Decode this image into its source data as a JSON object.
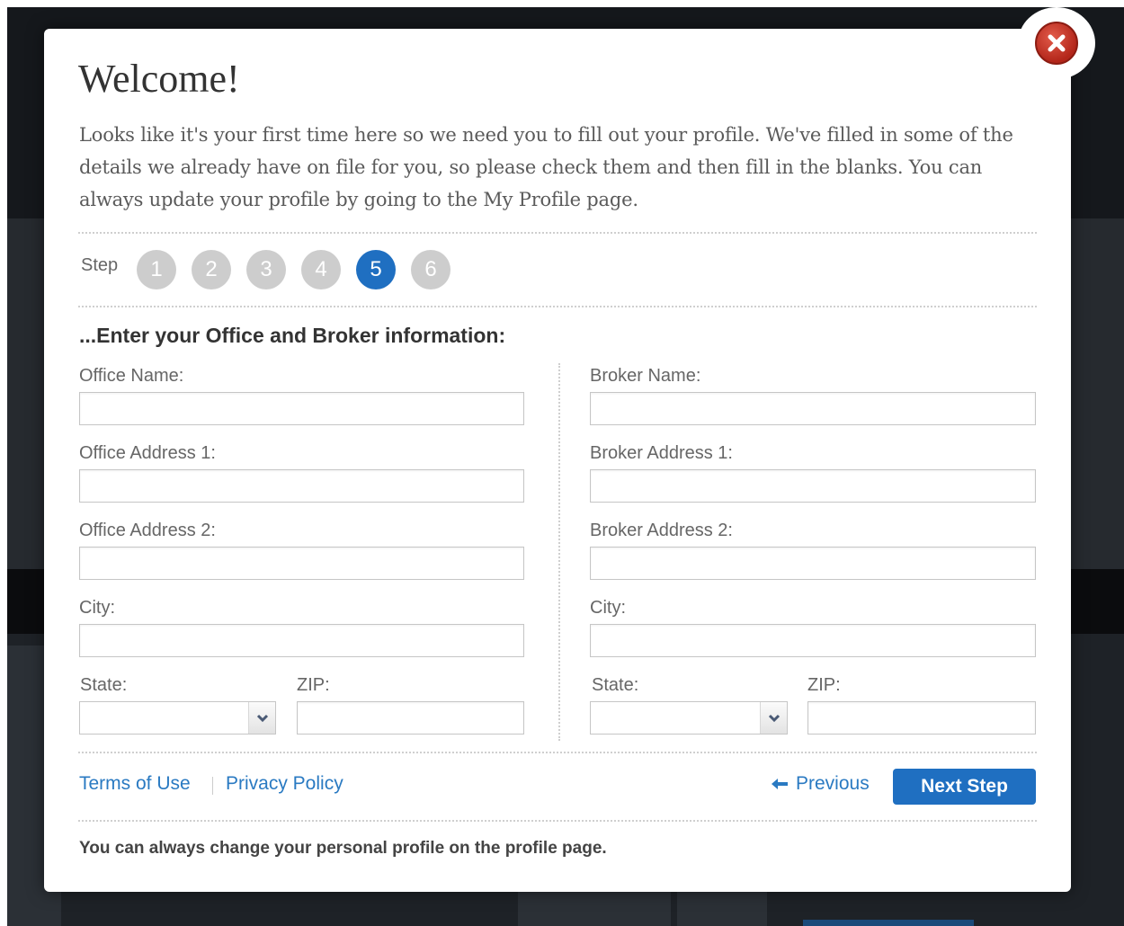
{
  "modal": {
    "title": "Welcome!",
    "intro": "Looks like it's your first time here so we need you to fill out your profile. We've filled in some of the details we already have on file for you, so please check them and then fill in the blanks. You can always update your profile by going to the My Profile page.",
    "close_icon": "close-icon"
  },
  "steps": {
    "label": "Step",
    "items": [
      "1",
      "2",
      "3",
      "4",
      "5",
      "6"
    ],
    "current": 5
  },
  "form": {
    "heading": "...Enter your Office and Broker information:",
    "office": {
      "name_label": "Office Name:",
      "name_value": "",
      "address1_label": "Office Address 1:",
      "address1_value": "",
      "address2_label": "Office Address 2:",
      "address2_value": "",
      "city_label": "City:",
      "city_value": "",
      "state_label": "State:",
      "state_value": "",
      "zip_label": "ZIP:",
      "zip_value": ""
    },
    "broker": {
      "name_label": "Broker Name:",
      "name_value": "",
      "address1_label": "Broker Address 1:",
      "address1_value": "",
      "address2_label": "Broker Address 2:",
      "address2_value": "",
      "city_label": "City:",
      "city_value": "",
      "state_label": "State:",
      "state_value": "",
      "zip_label": "ZIP:",
      "zip_value": ""
    }
  },
  "footer": {
    "terms_link": "Terms of Use",
    "privacy_link": "Privacy Policy",
    "previous_label": "Previous",
    "next_label": "Next Step",
    "note": "You can always change your personal profile on the profile page."
  },
  "colors": {
    "accent": "#1f6fc1",
    "link": "#2a7ac2",
    "step_inactive": "#cdcdcd",
    "close": "#c0392b"
  }
}
